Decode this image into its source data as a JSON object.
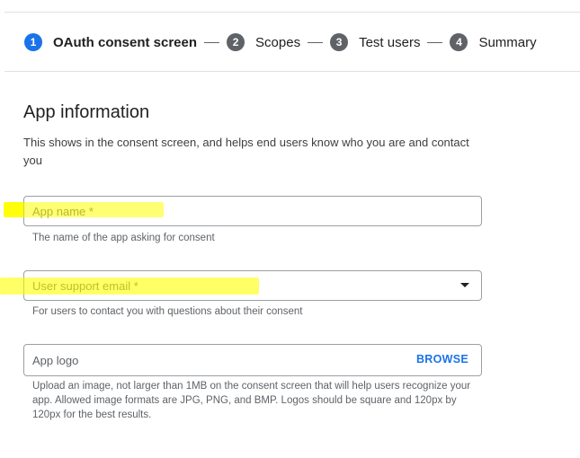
{
  "stepper": {
    "steps": [
      {
        "number": "1",
        "label": "OAuth consent screen",
        "active": true
      },
      {
        "number": "2",
        "label": "Scopes",
        "active": false
      },
      {
        "number": "3",
        "label": "Test users",
        "active": false
      },
      {
        "number": "4",
        "label": "Summary",
        "active": false
      }
    ]
  },
  "section": {
    "title": "App information",
    "description": "This shows in the consent screen, and helps end users know who you are and contact you"
  },
  "fields": {
    "app_name": {
      "label": "App name *",
      "value": "",
      "helper": "The name of the app asking for consent"
    },
    "support_email": {
      "label": "User support email *",
      "selected": "",
      "helper": "For users to contact you with questions about their consent"
    },
    "app_logo": {
      "label": "App logo",
      "browse_label": "BROWSE",
      "helper": "Upload an image, not larger than 1MB on the consent screen that will help users recognize your app. Allowed image formats are JPG, PNG, and BMP. Logos should be square and 120px by 120px for the best results."
    }
  },
  "colors": {
    "accent": "#1a73e8",
    "highlight": "#ffff00",
    "border": "#9aa0a6"
  }
}
